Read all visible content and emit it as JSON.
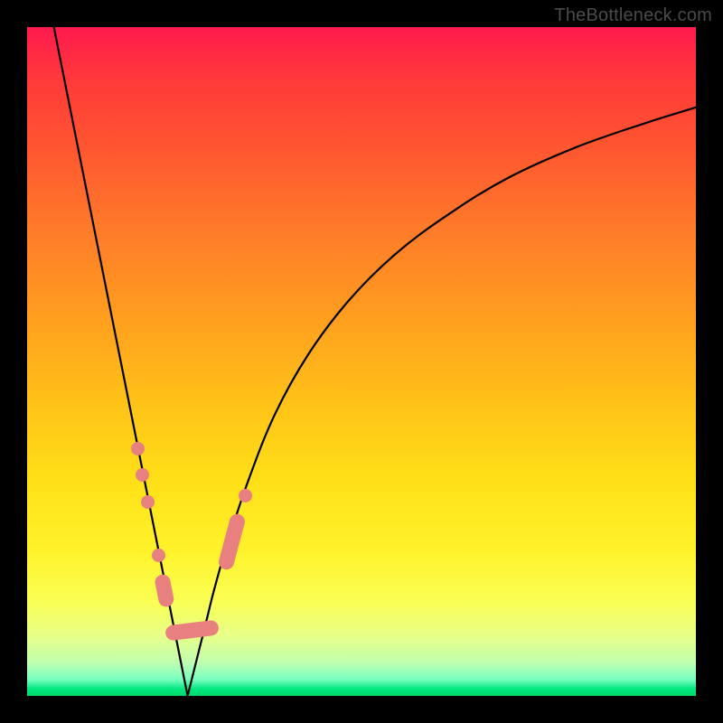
{
  "watermark": "TheBottleneck.com",
  "colors": {
    "frame": "#000000",
    "curve": "#000000",
    "marker": "#e98080",
    "gradient_top": "#ff1a4d",
    "gradient_bottom": "#00d86a"
  },
  "chart_data": {
    "type": "line",
    "title": "",
    "xlabel": "",
    "ylabel": "",
    "xlim": [
      0,
      100
    ],
    "ylim": [
      0,
      100
    ],
    "note": "Axes are implicit (no tick labels shown). Values estimated from pixel positions. y≈100 at top (red, high bottleneck), y≈0 at bottom (green, no bottleneck). Two curves forming a V-shaped well with minimum near x≈24.",
    "series": [
      {
        "name": "left-curve",
        "x": [
          4,
          6,
          8,
          10,
          12,
          14,
          16,
          18,
          19,
          20,
          21,
          22,
          23,
          24
        ],
        "y": [
          100,
          90,
          80,
          70,
          60,
          50,
          40,
          30,
          25,
          20,
          15,
          10,
          5,
          0
        ]
      },
      {
        "name": "right-curve",
        "x": [
          24,
          25,
          26,
          27,
          28,
          30,
          33,
          37,
          42,
          48,
          55,
          63,
          72,
          82,
          92,
          100
        ],
        "y": [
          0,
          4,
          8,
          12,
          16,
          23,
          32,
          42,
          51,
          59,
          66,
          72,
          77.5,
          82,
          85.5,
          88
        ]
      }
    ],
    "markers": {
      "name": "highlighted-segment",
      "note": "Salmon capsule/dot markers near the valley of the V on both branches.",
      "points": [
        {
          "x": 16.5,
          "y": 37
        },
        {
          "x": 17.2,
          "y": 33
        },
        {
          "x": 18.0,
          "y": 29
        },
        {
          "x": 19.6,
          "y": 21
        },
        {
          "x": 20.3,
          "y": 17
        },
        {
          "x": 20.8,
          "y": 14.5
        },
        {
          "x": 21.8,
          "y": 9.5
        },
        {
          "x": 22.4,
          "y": 6.5
        },
        {
          "x": 22.9,
          "y": 4.2
        },
        {
          "x": 23.5,
          "y": 2.3
        },
        {
          "x": 24.1,
          "y": 1.3
        },
        {
          "x": 24.8,
          "y": 1.4
        },
        {
          "x": 25.5,
          "y": 2.6
        },
        {
          "x": 26.4,
          "y": 5.5
        },
        {
          "x": 27.0,
          "y": 8.0
        },
        {
          "x": 27.5,
          "y": 10.2
        },
        {
          "x": 29.8,
          "y": 20
        },
        {
          "x": 30.6,
          "y": 23
        },
        {
          "x": 31.4,
          "y": 26
        },
        {
          "x": 32.6,
          "y": 30
        }
      ]
    }
  }
}
